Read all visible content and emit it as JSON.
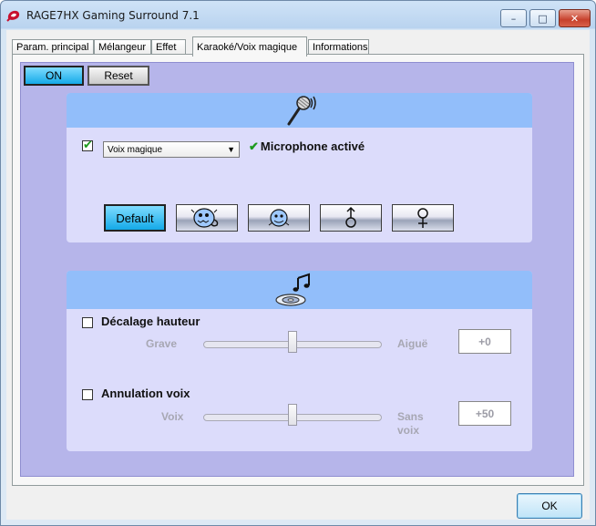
{
  "window": {
    "title": "RAGE7HX Gaming Surround 7.1",
    "minimize_glyph": "–",
    "maximize_glyph": "□",
    "close_glyph": "✕"
  },
  "tabs": [
    {
      "label": "Param. principal",
      "active": false
    },
    {
      "label": "Mélangeur",
      "active": false
    },
    {
      "label": "Effet",
      "active": false
    },
    {
      "label": "Karaoké/Voix magique",
      "active": true
    },
    {
      "label": "Informations",
      "active": false
    }
  ],
  "top_buttons": {
    "on_label": "ON",
    "reset_label": "Reset"
  },
  "voice_section": {
    "icon": "microphone-icon",
    "enabled_checked": true,
    "mode_select_value": "Voix magique",
    "mic_status": "Microphone activé",
    "effects": [
      {
        "name": "default",
        "label": "Default",
        "icon": null,
        "selected": true
      },
      {
        "name": "monster",
        "label": "",
        "icon": "monster-voice-icon",
        "selected": false
      },
      {
        "name": "cartoon",
        "label": "",
        "icon": "cartoon-voice-icon",
        "selected": false
      },
      {
        "name": "male",
        "label": "",
        "icon": "male-symbol-icon",
        "selected": false
      },
      {
        "name": "female",
        "label": "",
        "icon": "female-symbol-icon",
        "selected": false
      }
    ]
  },
  "karaoke_section": {
    "icon": "music-disc-icon",
    "pitch": {
      "label": "Décalage hauteur",
      "checked": false,
      "left_label": "Grave",
      "right_label": "Aiguë",
      "value_text": "+0",
      "level": 0.5
    },
    "voice_cancel": {
      "label": "Annulation voix",
      "checked": false,
      "left_label": "Voix",
      "right_label_line1": "Sans",
      "right_label_line2": "voix",
      "value_text": "+50",
      "level": 0.5
    }
  },
  "footer": {
    "ok_label": "OK"
  },
  "colors": {
    "panel_bg": "#b6b5ea",
    "section_bg": "#dcdcfb",
    "section_header": "#92befa",
    "active_button": "#14a9e8"
  }
}
